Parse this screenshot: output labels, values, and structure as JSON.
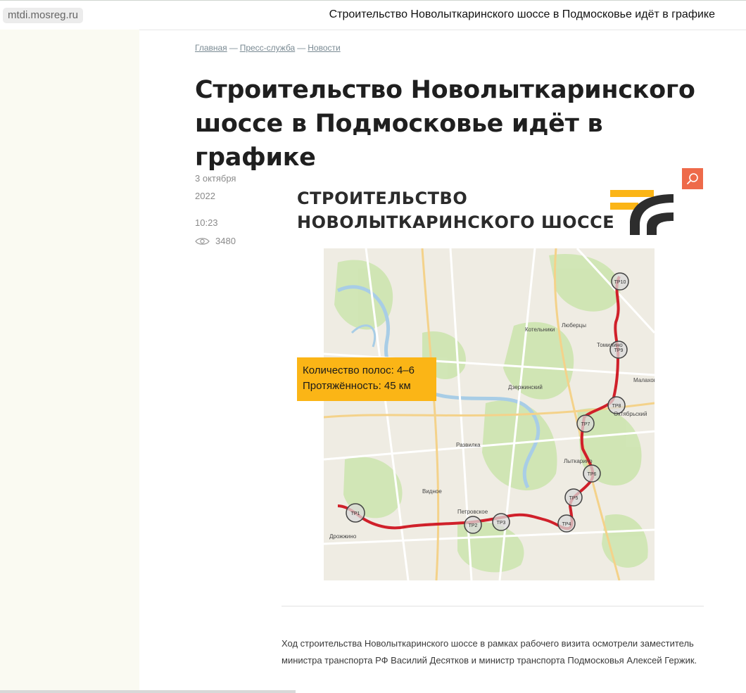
{
  "topbar": {
    "domain": "mtdi.mosreg.ru",
    "title": "Строительство Новолыткаринского шоссе в Подмосковье идёт в графике"
  },
  "breadcrumb": {
    "items": [
      "Главная",
      "Пресс-служба",
      "Новости"
    ],
    "separator": "—"
  },
  "article": {
    "title": "Строительство Новолыткаринского шоссе в Подмосковье идёт в графике",
    "date_day": "3 октября",
    "date_year": "2022",
    "time": "10:23",
    "views": "3480",
    "body": "Ход строительства Новолыткаринского шоссе в рамках рабочего визита осмотрели заместитель министра транспорта РФ Василий Десятков и министр транспорта Подмосковья Алексей Гержик."
  },
  "figure": {
    "title_line1": "СТРОИТЕЛЬСТВО",
    "title_line2": "НОВОЛЫТКАРИНСКОГО ШОССЕ",
    "info_lanes": "Количество полос: 4–6",
    "info_length": "Протяжённость: 45 км",
    "map_labels": [
      "Люберцы",
      "Котельники",
      "Томилино",
      "Дзержинский",
      "Лыткарино",
      "Октябрьский",
      "Развилка",
      "Видное",
      "Петровское",
      "Дрожжино",
      "Малаховка"
    ],
    "nodes": [
      "ТР1",
      "ТР2",
      "ТР3",
      "ТР4",
      "ТР5",
      "ТР6",
      "ТР7",
      "ТР8",
      "ТР9",
      "ТР10"
    ],
    "route_color": "#d0202a",
    "accent_color": "#fbb516"
  },
  "icons": {
    "zoom": "search-icon",
    "views": "eye-icon",
    "logo": "road-logo-icon"
  }
}
